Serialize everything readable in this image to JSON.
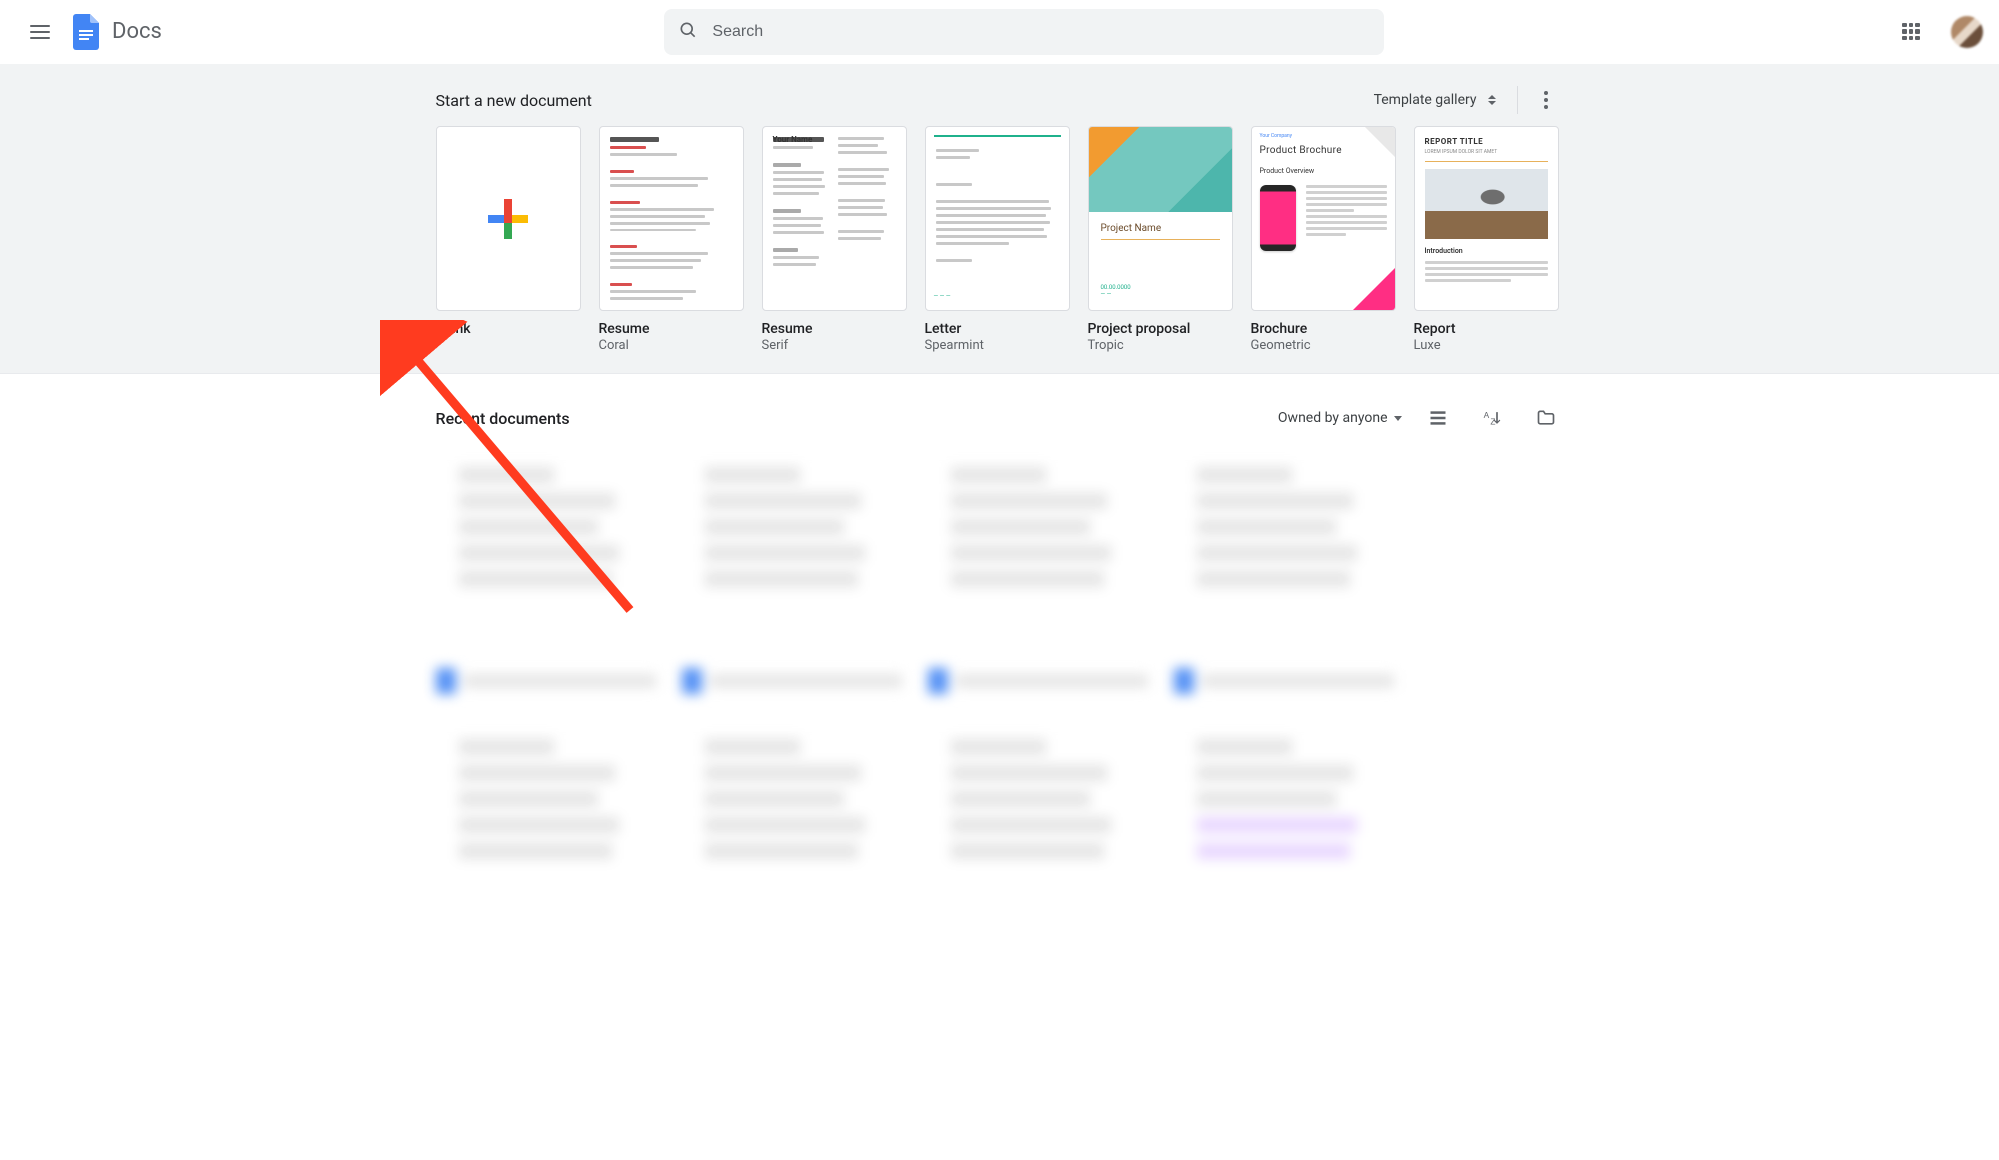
{
  "header": {
    "app_title": "Docs",
    "search_placeholder": "Search"
  },
  "templates": {
    "section_title": "Start a new document",
    "gallery_label": "Template gallery",
    "items": [
      {
        "title": "Blank",
        "subtitle": ""
      },
      {
        "title": "Resume",
        "subtitle": "Coral"
      },
      {
        "title": "Resume",
        "subtitle": "Serif"
      },
      {
        "title": "Letter",
        "subtitle": "Spearmint"
      },
      {
        "title": "Project proposal",
        "subtitle": "Tropic"
      },
      {
        "title": "Brochure",
        "subtitle": "Geometric"
      },
      {
        "title": "Report",
        "subtitle": "Luxe"
      }
    ],
    "proposal_thumb_title": "Project Name",
    "brochure_thumb_company": "Your Company",
    "brochure_thumb_title": "Product Brochure",
    "brochure_thumb_overview": "Product Overview",
    "report_thumb_title": "REPORT TITLE",
    "report_thumb_sub": "LOREM IPSUM DOLOR SIT AMET",
    "report_thumb_intro": "Introduction",
    "serif_thumb_name": "Your Name"
  },
  "recent": {
    "section_title": "Recent documents",
    "owned_label": "Owned by anyone"
  }
}
